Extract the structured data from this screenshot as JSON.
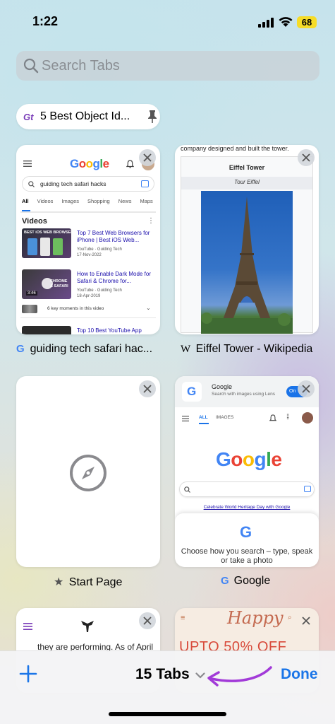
{
  "status_bar": {
    "time": "1:22",
    "battery": "68"
  },
  "search": {
    "placeholder": "Search Tabs"
  },
  "pinned_tab": {
    "logo": "Gt",
    "title": "5 Best Object Id..."
  },
  "tabs": [
    {
      "title": "guiding tech safari hac...",
      "preview": {
        "logo": "Google",
        "query": "guiding tech safari hacks",
        "filters": [
          "All",
          "Videos",
          "Images",
          "Shopping",
          "News",
          "Maps"
        ],
        "section": "Videos",
        "videos": [
          {
            "thumb_text": "BEST iOS WEB BROWSERS",
            "title": "Top 7 Best Web Browsers for iPhone | Best iOS Web...",
            "source": "YouTube · Guiding Tech",
            "date": "17-Nov-2022"
          },
          {
            "thumb_text": "CHROME & SAFARI",
            "duration": "3:46",
            "title": "How to Enable Dark Mode for Safari & Chrome for...",
            "source": "YouTube · Guiding Tech",
            "date": "18-Apr-2019"
          }
        ],
        "key_moments": "6 key moments in this video",
        "next_title": "Top 10 Best YouTube App"
      }
    },
    {
      "title": "Eiffel Tower - Wikipedia",
      "preview": {
        "top_text": "company designed and built the tower.",
        "heading": "Eiffel Tower",
        "subheading": "Tour Eiffel"
      }
    },
    {
      "title": "Start Page"
    },
    {
      "title": "Google",
      "preview": {
        "banner_title": "Google",
        "banner_sub": "Search with images using Lens",
        "toggle": "On",
        "nav": [
          "ALL",
          "IMAGES"
        ],
        "logo": "Google",
        "doodle_link": "Celebrate World Heritage Day with Google",
        "sheet_text": "Choose how you search – type, speak or take a photo"
      }
    },
    {
      "preview": {
        "text": "they are performing. As of April"
      }
    },
    {
      "preview": {
        "script_text": "Happy",
        "promo": "UPTO 50% OFF"
      }
    }
  ],
  "bottom_bar": {
    "tabs_count": "15 Tabs",
    "done": "Done"
  },
  "colors": {
    "accent": "#1a75e8",
    "annotation_arrow": "#a23ad8"
  }
}
